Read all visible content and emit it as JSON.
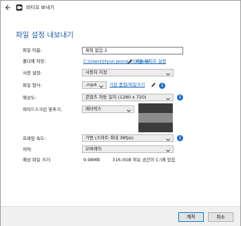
{
  "window": {
    "title": "비디오 보내기"
  },
  "page": {
    "heading": "파일 설정 내보내기"
  },
  "fields": {
    "filename": {
      "label": "파일 이름:",
      "value": "제목 없음 2"
    },
    "save_folder": {
      "label": "폴더에 저장:",
      "path": "C:\\Users\\Hyun Jeong Ki\\Videos",
      "reset_link": "기본 위치로 설정"
    },
    "preset": {
      "label": "사전 설정:",
      "value": "사용자 지정"
    },
    "format": {
      "label": "파일 형식:",
      "value": ".mp4",
      "quality_link": "기본 품질/파일크기"
    },
    "resolution": {
      "label": "해상도:",
      "value": "콘텐츠 자동 일치 (1280 x 720)"
    },
    "widescreen": {
      "label": "와이드스크린 맞추기:",
      "value": "레터박스"
    },
    "framerate": {
      "label": "프레임 속도:",
      "value": "가변 (스마트 최대 38fps)"
    },
    "subtitles": {
      "label": "자막:",
      "value": "오버레이"
    },
    "estimate": {
      "label": "예상 파일 크기:",
      "size": "9.98MB",
      "free_space": "316.0GB 여유 공간이 C:\\에 있음"
    }
  },
  "buttons": {
    "export": "제작",
    "cancel": "취소"
  },
  "colors": {
    "accent": "#1f6fc4",
    "heading": "#1f5e9c",
    "link": "#0a5fb4"
  },
  "icons": [
    "back-arrow-icon",
    "app-icon",
    "pencil-icon",
    "info-icon",
    "chevron-down-icon"
  ]
}
